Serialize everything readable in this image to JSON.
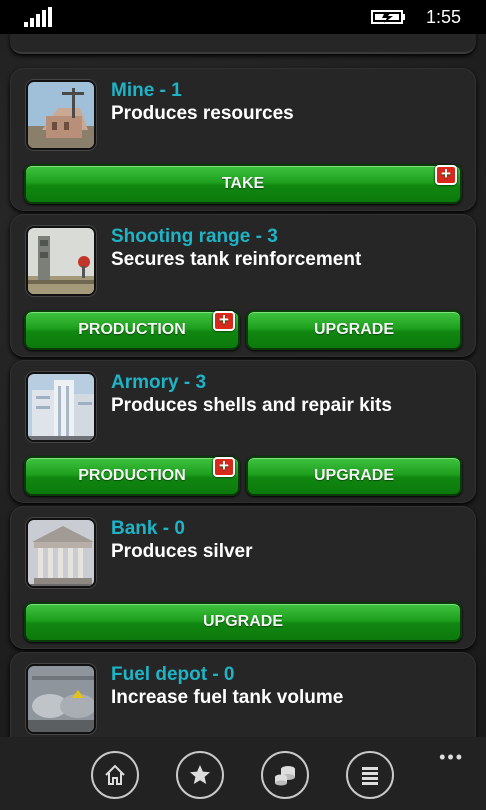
{
  "status": {
    "time": "1:55"
  },
  "buildings": [
    {
      "title": "Mine - 1",
      "desc": "Produces resources",
      "buttons": [
        "TAKE"
      ]
    },
    {
      "title": "Shooting range - 3",
      "desc": "Secures tank reinforcement",
      "buttons": [
        "PRODUCTION",
        "UPGRADE"
      ]
    },
    {
      "title": "Armory - 3",
      "desc": "Produces shells and repair kits",
      "buttons": [
        "PRODUCTION",
        "UPGRADE"
      ]
    },
    {
      "title": "Bank - 0",
      "desc": "Produces silver",
      "buttons": [
        "UPGRADE"
      ]
    },
    {
      "title": "Fuel depot - 0",
      "desc": "Increase fuel tank volume",
      "buttons": []
    }
  ],
  "badge": "+",
  "appbar": {
    "icons": [
      "home-icon",
      "star-icon",
      "coins-icon",
      "menu-list-icon"
    ],
    "more": "•••"
  },
  "colors": {
    "title": "#1fb3c6",
    "button": "#1ea11e",
    "badge": "#d6281d"
  }
}
